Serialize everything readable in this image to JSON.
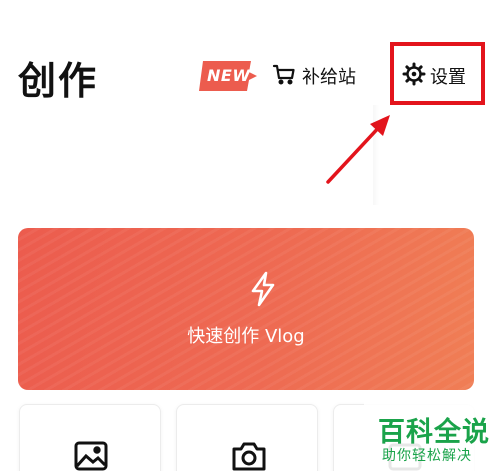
{
  "header": {
    "title": "创作",
    "new_badge": "NEW",
    "supply_label": "补给站",
    "settings_label": "设置"
  },
  "vlog_card": {
    "label": "快速创作 Vlog"
  },
  "tools": [
    {
      "icon": "image-icon"
    },
    {
      "icon": "camera-icon"
    },
    {
      "icon": "video-icon"
    }
  ],
  "watermark": {
    "title": "百科全说",
    "subtitle": "助你轻松解决"
  },
  "colors": {
    "accent": "#ec5c4e",
    "highlight": "#e3141c",
    "watermark": "#1aa34a"
  }
}
